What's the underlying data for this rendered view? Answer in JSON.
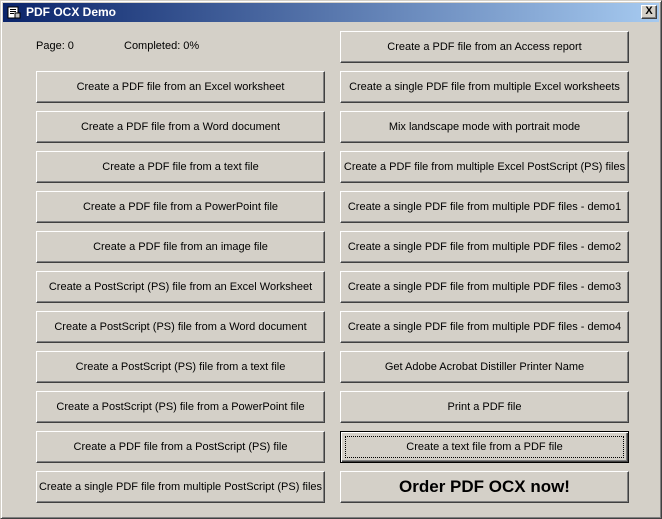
{
  "window": {
    "title": "PDF OCX Demo",
    "close_label": "X"
  },
  "status": {
    "page": "Page: 0",
    "completed": "Completed: 0%"
  },
  "left_buttons": [
    "Create a PDF file from an Excel worksheet",
    "Create a PDF file from a Word document",
    "Create a PDF file from a text file",
    "Create a PDF file from a PowerPoint file",
    "Create a PDF file from an image file",
    "Create a PostScript (PS) file from an Excel Worksheet",
    "Create a PostScript (PS) file from a Word document",
    "Create a PostScript (PS) file from a text file",
    "Create a PostScript (PS) file from a PowerPoint file",
    "Create a PDF file from a PostScript (PS) file",
    "Create a single PDF file from multiple PostScript (PS) files"
  ],
  "right_buttons": [
    "Create a PDF file from an Access report",
    "Create a single PDF file from multiple Excel worksheets",
    "Mix landscape mode with portrait mode",
    "Create a PDF file from multiple Excel PostScript (PS) files",
    "Create a single PDF file from multiple PDF files - demo1",
    "Create a single PDF file from multiple PDF files - demo2",
    "Create a single PDF file from multiple PDF files - demo3",
    "Create a single PDF file from multiple PDF files - demo4",
    "Get Adobe Acrobat Distiller Printer Name",
    "Print a PDF file",
    "Create a text file from a PDF file",
    "Order PDF OCX now!"
  ]
}
